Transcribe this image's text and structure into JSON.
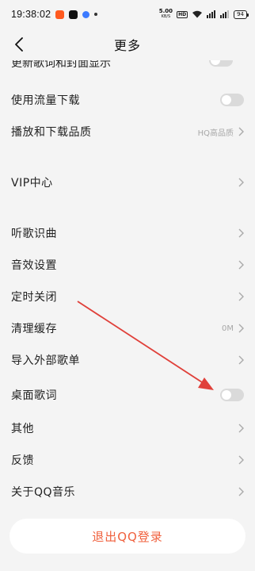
{
  "status_bar": {
    "time": "19:38:02",
    "net_speed": "5.00",
    "net_unit": "KB/S",
    "hd": "HD",
    "battery": "94",
    "apps": [
      "orange-app-icon",
      "tiktok-icon",
      "blue-app-icon"
    ]
  },
  "header": {
    "title": "更多",
    "back_icon": "chevron-left-icon"
  },
  "settings": {
    "partial_label": "更新歌词和封面显示",
    "mobile_download": {
      "label": "使用流量下载",
      "enabled": false
    },
    "quality": {
      "label": "播放和下载品质",
      "value": "HQ高品质"
    },
    "vip": {
      "label": "VIP中心"
    },
    "recognize": {
      "label": "听歌识曲"
    },
    "sound_effects": {
      "label": "音效设置"
    },
    "timer": {
      "label": "定时关闭"
    },
    "cache": {
      "label": "清理缓存",
      "value": "0M"
    },
    "import": {
      "label": "导入外部歌单"
    },
    "desktop_lyrics": {
      "label": "桌面歌词",
      "enabled": false
    },
    "other": {
      "label": "其他"
    },
    "feedback": {
      "label": "反馈"
    },
    "about": {
      "label": "关于QQ音乐"
    }
  },
  "logout": {
    "label": "退出QQ登录"
  },
  "colors": {
    "background": "#f4f4f4",
    "logout_text": "#f0613e",
    "annotation_arrow": "#e0403a",
    "toggle_off": "#dadada"
  }
}
